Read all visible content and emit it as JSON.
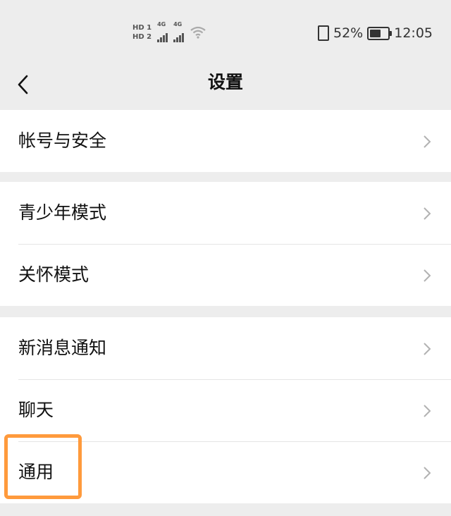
{
  "status_bar": {
    "sim1": "HD 1",
    "sim2": "HD 2",
    "signal_tag": "4G",
    "battery_percent": "52%",
    "time": "12:05"
  },
  "nav": {
    "title": "设置",
    "back_icon": "chevron-left-icon"
  },
  "groups": [
    {
      "items": [
        {
          "label": "帐号与安全"
        }
      ]
    },
    {
      "items": [
        {
          "label": "青少年模式"
        },
        {
          "label": "关怀模式"
        }
      ]
    },
    {
      "items": [
        {
          "label": "新消息通知"
        },
        {
          "label": "聊天"
        },
        {
          "label": "通用"
        }
      ]
    }
  ],
  "highlight": {
    "target": "通用",
    "color": "#ff9a3c"
  },
  "colors": {
    "background": "#ededed",
    "card": "#ffffff",
    "chevron": "#b2b2b2"
  }
}
